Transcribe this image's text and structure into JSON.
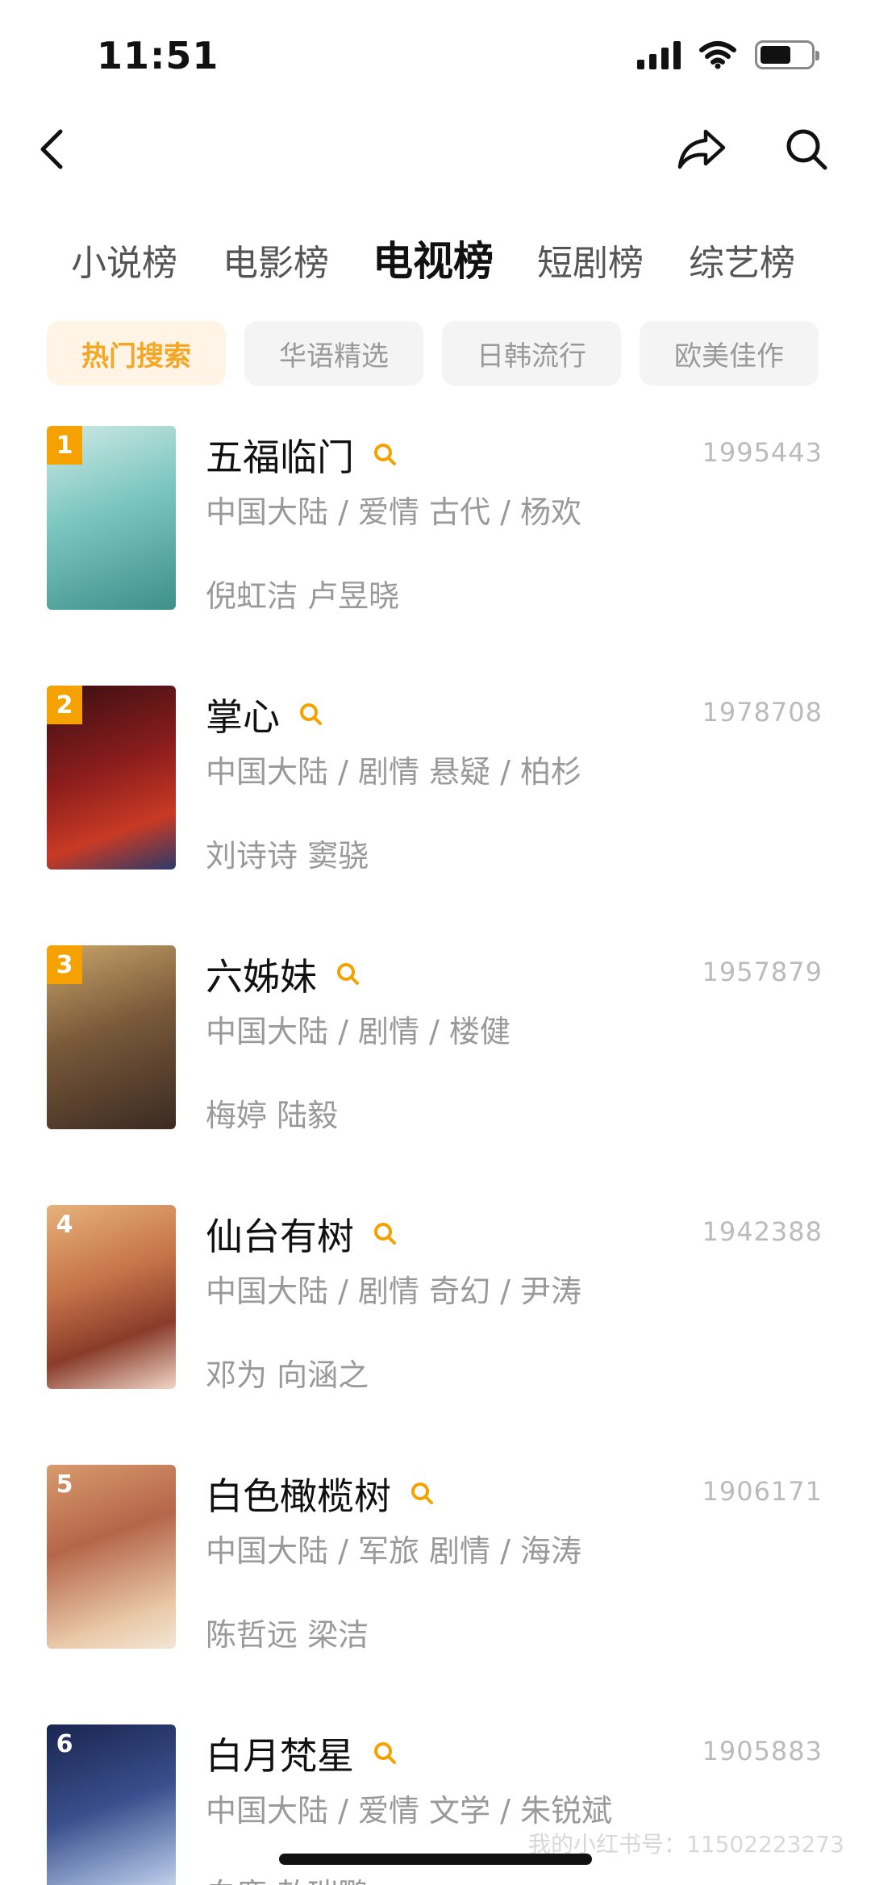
{
  "status": {
    "time": "11:51"
  },
  "categories": [
    {
      "label": "小说榜",
      "active": false
    },
    {
      "label": "电影榜",
      "active": false
    },
    {
      "label": "电视榜",
      "active": true
    },
    {
      "label": "短剧榜",
      "active": false
    },
    {
      "label": "综艺榜",
      "active": false
    }
  ],
  "filters": [
    {
      "label": "热门搜索",
      "active": true
    },
    {
      "label": "华语精选",
      "active": false
    },
    {
      "label": "日韩流行",
      "active": false
    },
    {
      "label": "欧美佳作",
      "active": false
    }
  ],
  "items": [
    {
      "rank": "1",
      "title": "五福临门",
      "count": "1995443",
      "meta": "中国大陆 / 爱情 古代 / 杨欢",
      "cast": "倪虹洁 卢昱晓"
    },
    {
      "rank": "2",
      "title": "掌心",
      "count": "1978708",
      "meta": "中国大陆 / 剧情 悬疑 / 柏杉",
      "cast": "刘诗诗 窦骁"
    },
    {
      "rank": "3",
      "title": "六姊妹",
      "count": "1957879",
      "meta": "中国大陆 / 剧情 / 楼健",
      "cast": "梅婷 陆毅"
    },
    {
      "rank": "4",
      "title": "仙台有树",
      "count": "1942388",
      "meta": "中国大陆 / 剧情 奇幻 / 尹涛",
      "cast": "邓为 向涵之"
    },
    {
      "rank": "5",
      "title": "白色橄榄树",
      "count": "1906171",
      "meta": "中国大陆 / 军旅 剧情 / 海涛",
      "cast": "陈哲远 梁洁"
    },
    {
      "rank": "6",
      "title": "白月梵星",
      "count": "1905883",
      "meta": "中国大陆 / 爱情 文学 / 朱锐斌",
      "cast": "白鹿 敖瑞鹏"
    }
  ],
  "watermark": "我的小红书号：11502223273",
  "colors": {
    "accent": "#f5a100",
    "chip_active_bg": "#fff4e5",
    "muted_text": "#999999"
  }
}
